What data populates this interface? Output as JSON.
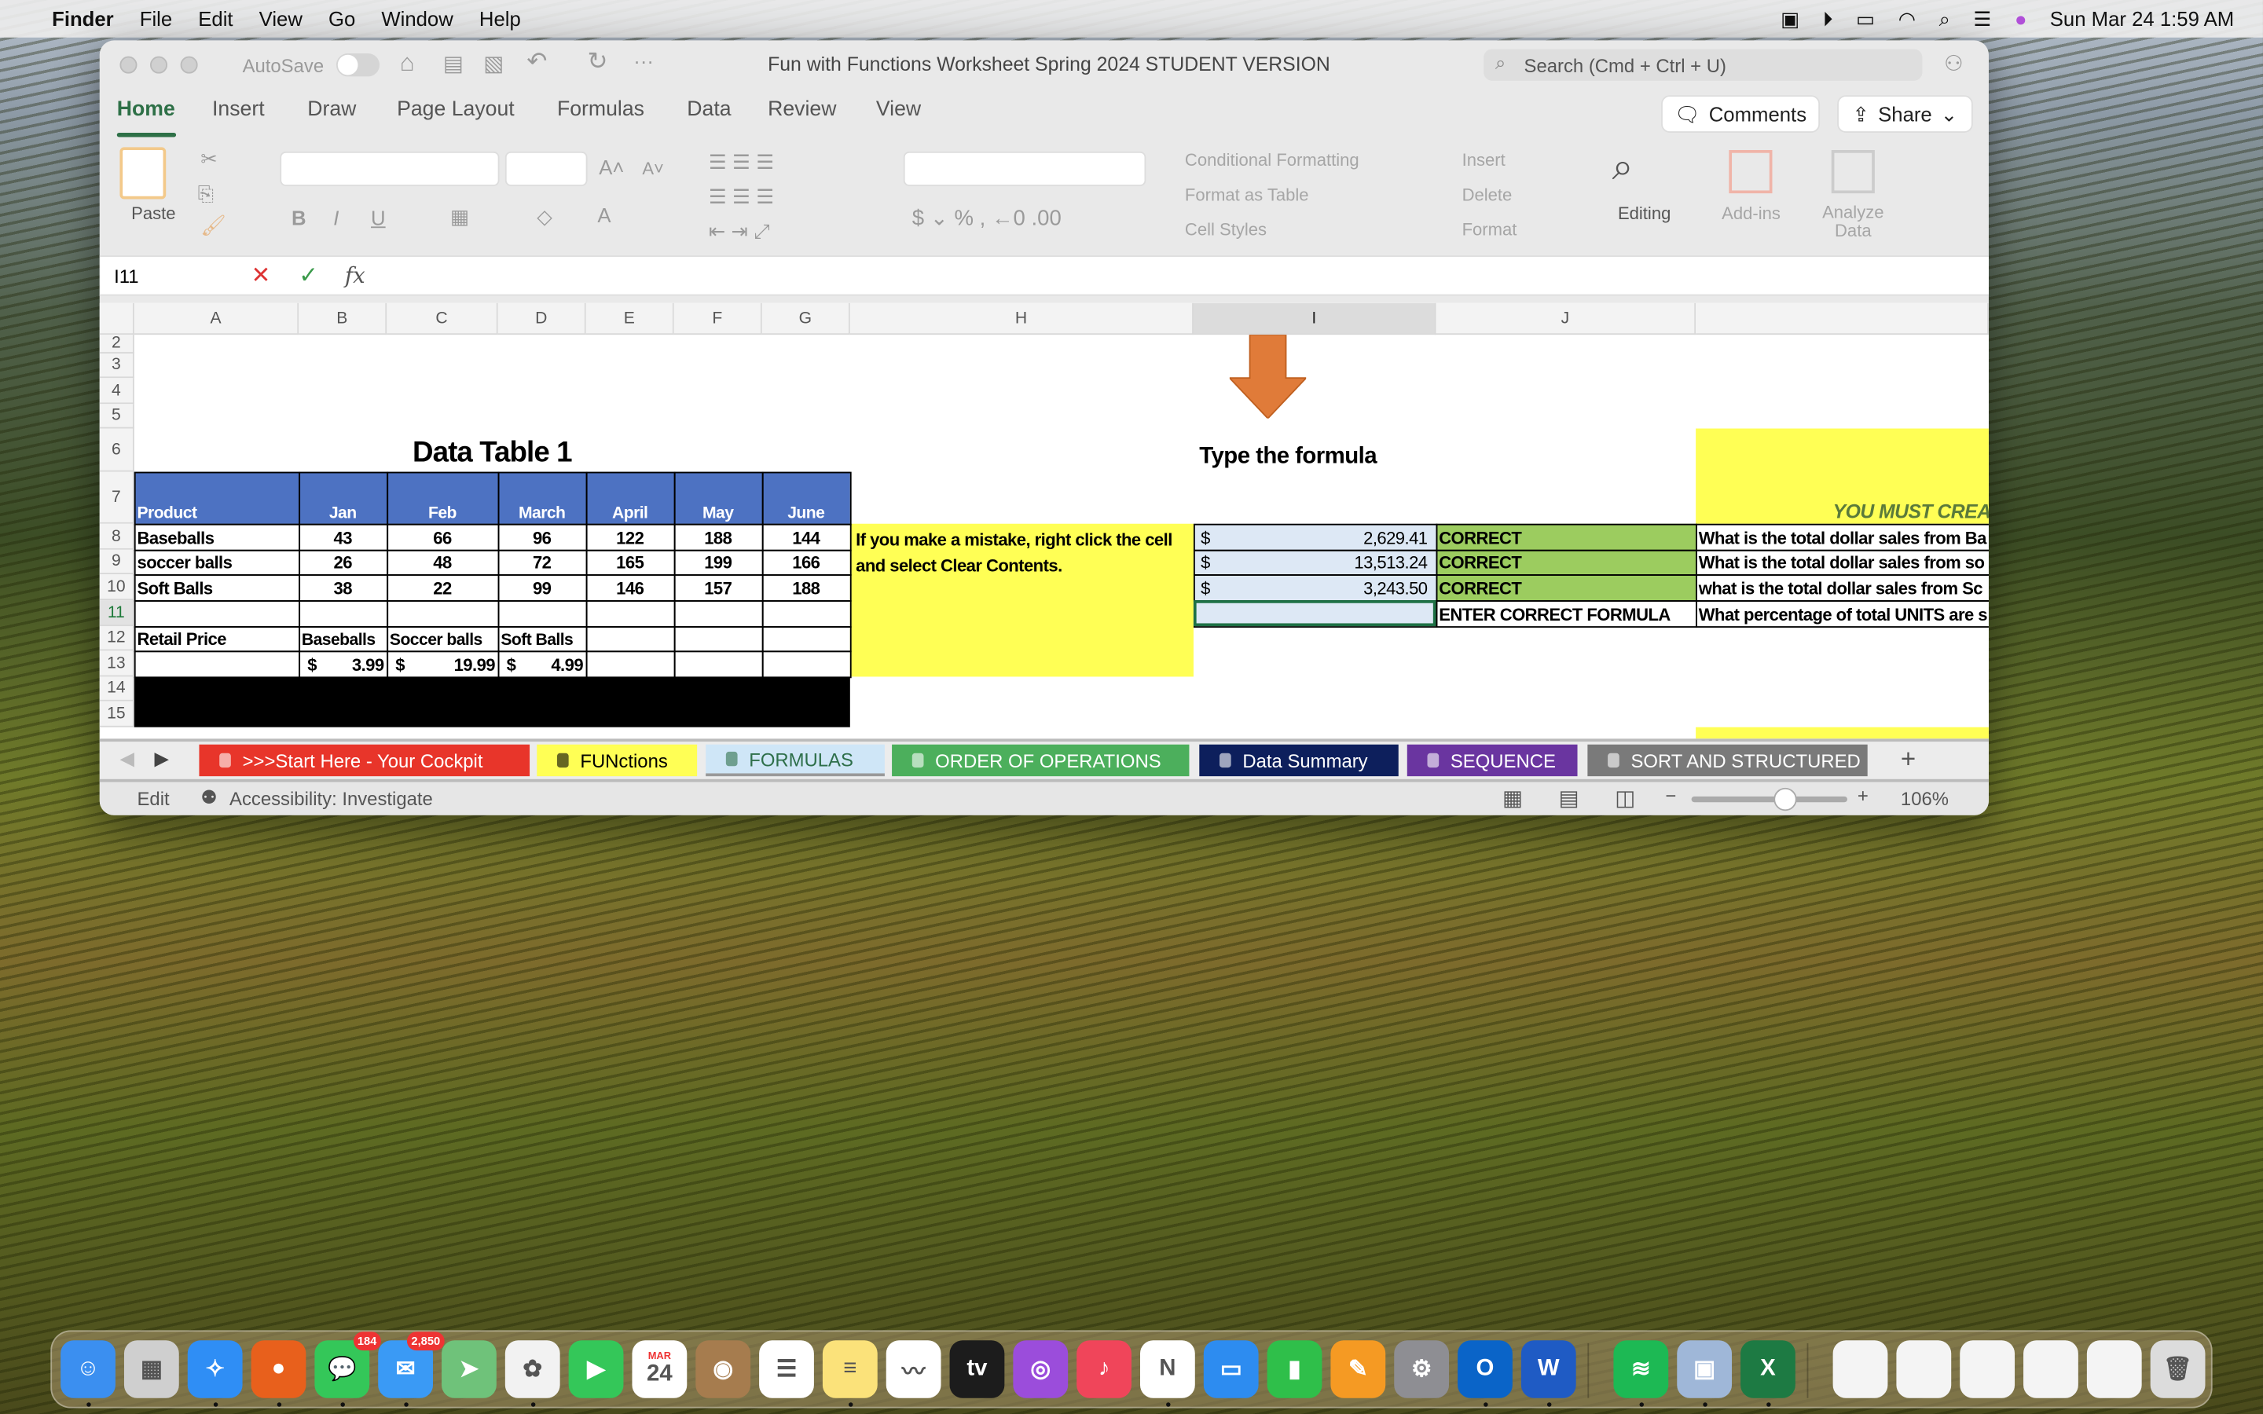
{
  "menubar": {
    "app": "Finder",
    "items": [
      "File",
      "Edit",
      "View",
      "Go",
      "Window",
      "Help"
    ],
    "clock": "Sun Mar 24  1:59 AM"
  },
  "titlebar": {
    "autosave": "AutoSave",
    "title": "Fun with Functions Worksheet Spring 2024 STUDENT VERSION",
    "search_placeholder": "Search (Cmd + Ctrl + U)"
  },
  "ribbon_tabs": [
    "Home",
    "Insert",
    "Draw",
    "Page Layout",
    "Formulas",
    "Data",
    "Review",
    "View"
  ],
  "active_tab": "Home",
  "buttons": {
    "comments": "Comments",
    "share": "Share"
  },
  "ribbon": {
    "paste": "Paste",
    "conditional_formatting": "Conditional Formatting",
    "format_as_table": "Format as Table",
    "cell_styles": "Cell Styles",
    "insert": "Insert",
    "delete": "Delete",
    "format": "Format",
    "editing": "Editing",
    "addins": "Add-ins",
    "analyze": "Analyze Data"
  },
  "formula_bar": {
    "name_box": "I11",
    "fx": "fx",
    "value": ""
  },
  "columns": [
    "A",
    "B",
    "C",
    "D",
    "E",
    "F",
    "G",
    "H",
    "I",
    "J"
  ],
  "selected_cell": "I11",
  "rows": [
    "2",
    "3",
    "4",
    "5",
    "6",
    "7",
    "8",
    "9",
    "10",
    "11",
    "12",
    "13",
    "14",
    "15"
  ],
  "sheet": {
    "title": "Data Table 1",
    "headers": [
      "Product",
      "Jan",
      "Feb",
      "March",
      "April",
      "May",
      "June"
    ],
    "data": [
      [
        "Baseballs",
        "43",
        "66",
        "96",
        "122",
        "188",
        "144"
      ],
      [
        "soccer balls",
        "26",
        "48",
        "72",
        "165",
        "199",
        "166"
      ],
      [
        "Soft Balls",
        "38",
        "22",
        "99",
        "146",
        "157",
        "188"
      ]
    ],
    "retail_label": "Retail Price",
    "retail_headers": [
      "Baseballs",
      "Soccer balls",
      "Soft Balls"
    ],
    "retail_prices": [
      "3.99",
      "19.99",
      "4.99"
    ],
    "currency": "$",
    "note": "If you make a mistake, right click the cell and select Clear Contents.",
    "formula_title": "Type the formula",
    "answers": [
      "2,629.41",
      "13,513.24",
      "3,243.50",
      ""
    ],
    "status": [
      "CORRECT",
      "CORRECT",
      "CORRECT",
      "ENTER CORRECT FORMULA"
    ],
    "questions": [
      "What is the total dollar sales from Ba",
      "What is the total dollar sales from so",
      "what is the total   dollar sales from Sc",
      "What percentage of total UNITS are s"
    ],
    "banner": "YOU MUST CREA"
  },
  "sheet_tabs": [
    {
      "label": ">>>Start Here - Your Cockpit",
      "color": "#e8352a",
      "text": "#ffffff"
    },
    {
      "label": "FUNctions",
      "color": "#ffff55",
      "text": "#000000"
    },
    {
      "label": "FORMULAS",
      "color": "#cfe6f7",
      "text": "#2e6f4a",
      "active": true
    },
    {
      "label": "ORDER OF OPERATIONS",
      "color": "#4caf5c",
      "text": "#ffffff"
    },
    {
      "label": "Data Summary",
      "color": "#0d1f5c",
      "text": "#ffffff"
    },
    {
      "label": "SEQUENCE",
      "color": "#6a35a0",
      "text": "#ffffff"
    },
    {
      "label": "SORT AND STRUCTURED",
      "color": "#7a7a7a",
      "text": "#ffffff"
    }
  ],
  "statusbar": {
    "mode": "Edit",
    "accessibility": "Accessibility: Investigate",
    "zoom": "106%",
    "zoom_level": 0.6
  },
  "dock": [
    {
      "name": "finder",
      "color": "#3b8ff0",
      "g": "☺"
    },
    {
      "name": "launchpad",
      "color": "#cfcfcf",
      "g": "▦"
    },
    {
      "name": "safari",
      "color": "#2f8ef5",
      "g": "✧"
    },
    {
      "name": "firefox",
      "color": "#e8601c",
      "g": "●"
    },
    {
      "name": "messages",
      "color": "#34c759",
      "g": "💬",
      "badge": "184"
    },
    {
      "name": "mail",
      "color": "#3a9af5",
      "g": "✉",
      "badge": "2,850"
    },
    {
      "name": "maps",
      "color": "#6fc27a",
      "g": "➤"
    },
    {
      "name": "photos",
      "color": "#f2f2f2",
      "g": "✿"
    },
    {
      "name": "facetime",
      "color": "#34c759",
      "g": "▶"
    },
    {
      "name": "calendar",
      "color": "#ffffff",
      "g": "24",
      "month": "MAR"
    },
    {
      "name": "contacts",
      "color": "#a67c4e",
      "g": "◉"
    },
    {
      "name": "reminders",
      "color": "#ffffff",
      "g": "☰"
    },
    {
      "name": "notes",
      "color": "#fbe27a",
      "g": "≡"
    },
    {
      "name": "freeform",
      "color": "#ffffff",
      "g": "〰"
    },
    {
      "name": "tv",
      "color": "#1c1c1c",
      "g": "tv"
    },
    {
      "name": "podcasts",
      "color": "#9b4ddb",
      "g": "◎"
    },
    {
      "name": "music",
      "color": "#f0455a",
      "g": "♪"
    },
    {
      "name": "news",
      "color": "#ffffff",
      "g": "N"
    },
    {
      "name": "keynote",
      "color": "#2d8cf0",
      "g": "▭"
    },
    {
      "name": "numbers",
      "color": "#2fbf4a",
      "g": "▮"
    },
    {
      "name": "pages",
      "color": "#f59a23",
      "g": "✎"
    },
    {
      "name": "system-settings",
      "color": "#8e8e93",
      "g": "⚙"
    },
    {
      "name": "outlook",
      "color": "#0a64c8",
      "g": "O"
    },
    {
      "name": "word",
      "color": "#1f5bc4",
      "g": "W"
    },
    {
      "name": "spotify",
      "color": "#1db954",
      "g": "≋"
    },
    {
      "name": "preview",
      "color": "#9fb7d8",
      "g": "▣"
    },
    {
      "name": "excel",
      "color": "#1d7a43",
      "g": "X"
    },
    {
      "name": "window-1",
      "color": "#f4f4f4",
      "g": ""
    },
    {
      "name": "window-2",
      "color": "#f4f4f4",
      "g": ""
    },
    {
      "name": "window-3",
      "color": "#f4f4f4",
      "g": ""
    },
    {
      "name": "window-4",
      "color": "#f4f4f4",
      "g": ""
    },
    {
      "name": "window-5",
      "color": "#f4f4f4",
      "g": ""
    },
    {
      "name": "trash",
      "color": "#dcdcdc",
      "g": "🗑"
    }
  ]
}
